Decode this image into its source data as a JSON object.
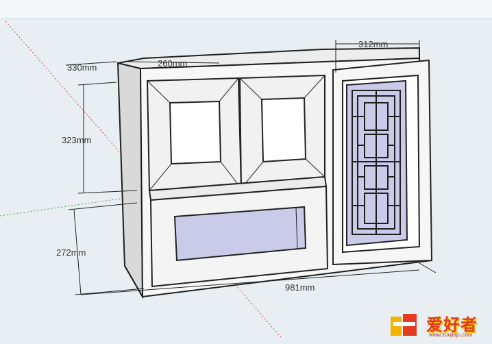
{
  "dimensions": {
    "top_width": "312mm",
    "depth": "330mm",
    "top_depth_overlap": "260mm",
    "upper_height": "323mm",
    "lower_height": "272mm",
    "total_width": "981mm"
  },
  "watermark": {
    "brand": "爱好者",
    "url": "www.zuojiaju.com"
  },
  "colors": {
    "background": "#e8eef1",
    "face": "#f7f7f7",
    "glass": "#c9cbe8",
    "edge": "#1f1f1f",
    "axis_red": "#d24a4a",
    "axis_green": "#4aa35a"
  }
}
